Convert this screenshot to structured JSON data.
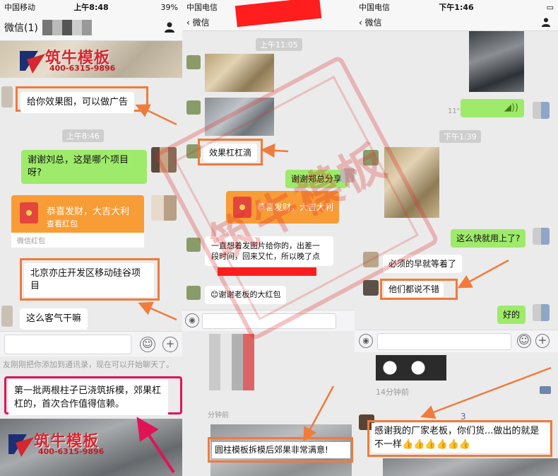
{
  "left": {
    "status": {
      "carrier": "中国移动",
      "time": "上午8:48",
      "battery": "39%"
    },
    "nav": {
      "title": "微信(1)"
    },
    "logo_top": {
      "name": "筑牛模板",
      "phone": "400-6315-9896"
    },
    "timestamp": "上午8:46",
    "msg_ad": "给你效果图，可以做广告",
    "msg_thanks": "谢谢刘总，这是哪个项目呀?",
    "redpacket": {
      "text": "恭喜发财，大吉大利",
      "sub": "查看红包",
      "footer": "微信红包"
    },
    "msg_project": "北京亦庄开发区移动硅谷项目",
    "msg_polite": "这么客气干嘛",
    "system_note": "友刚刚把你添加到通讯录，现在可以开始聊天了。",
    "callout": "第一批两根柱子已浇筑拆模，郊果杠杠的，首次合作值得信赖。",
    "logo_bottom": {
      "name": "筑牛模板",
      "phone": "400-6315-9896"
    }
  },
  "middle": {
    "status": {
      "carrier": "中国电信"
    },
    "nav": {
      "back": "微信"
    },
    "timestamp": "上午11:05",
    "msg_effect": "效果杠杠滴",
    "msg_thanks": "谢谢郑总分享",
    "redpacket": {
      "text": "恭喜发财，大吉大利"
    },
    "msg_sorry": "一直想着发图片给你的，出差一段时间，回来又忙，所以晚了点",
    "msg_bigred": "😊谢谢老板的大红包",
    "moments_time": "分钟前",
    "caption": "圆柱模板拆模后郊果非常满意!"
  },
  "right": {
    "status": {
      "carrier": "中国电信",
      "time": "下午1:46"
    },
    "nav": {
      "back": "微信"
    },
    "voice_len": "11\"",
    "timestamp": "下午1:39",
    "msg_fast": "这么快就用上了?",
    "msg_waiting": "必须的早就等着了",
    "msg_good": "他们都说不错",
    "msg_ok": "好的",
    "moments_time": "14分钟前",
    "likes_count": "3",
    "testimonial": "感谢我的厂家老板，你们货...做出的就是不一样👍👍👍👍👍👍"
  },
  "stamp": {
    "text": "筑牛模板"
  },
  "colors": {
    "wechat_green": "#9eea6a",
    "orange": "#f07b3c",
    "red_accent": "#e01455",
    "redpacket": "#f89c35"
  }
}
